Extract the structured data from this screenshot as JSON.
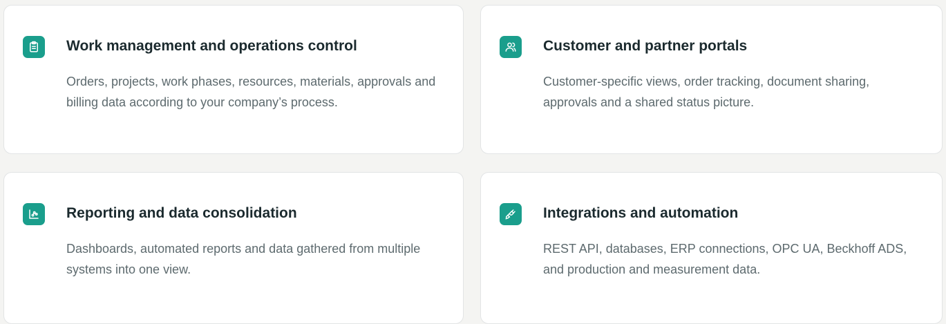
{
  "colors": {
    "accent": "#1a9e8c",
    "title": "#1b2a2e",
    "body_text": "#5d6a6e",
    "card_border": "#e2e4e5",
    "page_background": "#f4f4f2"
  },
  "cards": [
    {
      "icon": "clipboard-icon",
      "title": "Work management and operations control",
      "description": "Orders, projects, work phases, resources, materials, approvals and billing data according to your company’s process."
    },
    {
      "icon": "users-icon",
      "title": "Customer and partner portals",
      "description": "Customer-specific views, order tracking, document sharing, approvals and a shared status picture."
    },
    {
      "icon": "chart-icon",
      "title": "Reporting and data consolidation",
      "description": "Dashboards, automated reports and data gathered from multiple systems into one view."
    },
    {
      "icon": "plug-icon",
      "title": "Integrations and automation",
      "description": "REST API, databases, ERP connections, OPC UA, Beckhoff ADS, and production and measurement data."
    }
  ]
}
